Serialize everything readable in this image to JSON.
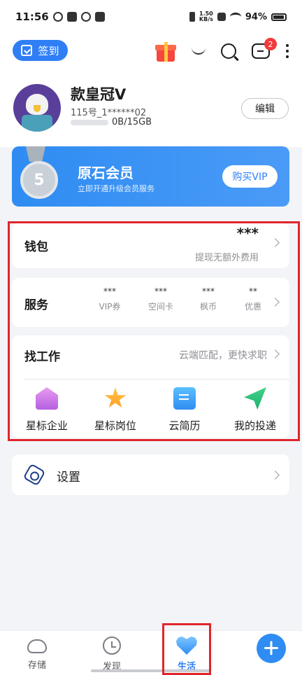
{
  "status_bar": {
    "time": "11:56",
    "net_speed_top": "1.50",
    "net_speed_bottom": "KB/s",
    "battery": "94%"
  },
  "header": {
    "checkin_label": "签到",
    "message_badge": "2"
  },
  "profile": {
    "name": "款皇冠V",
    "id": "115号_1******02",
    "storage": "0B/15GB",
    "edit_label": "编辑"
  },
  "vip": {
    "medal_level": "5",
    "title": "原石会员",
    "subtitle": "立即开通升级会员服务",
    "button": "购买VIP"
  },
  "wallet": {
    "title": "钱包",
    "balance": "***",
    "note": "提现无额外费用"
  },
  "services": {
    "title": "服务",
    "items": [
      {
        "value": "***",
        "label": "VIP券"
      },
      {
        "value": "***",
        "label": "空间卡"
      },
      {
        "value": "***",
        "label": "枫币"
      },
      {
        "value": "**",
        "label": "优惠"
      }
    ]
  },
  "jobs": {
    "title": "找工作",
    "slogan": "云端匹配，更快求职",
    "items": [
      {
        "label": "星标企业",
        "icon": "building-icon"
      },
      {
        "label": "星标岗位",
        "icon": "star-icon"
      },
      {
        "label": "云简历",
        "icon": "resume-icon"
      },
      {
        "label": "我的投递",
        "icon": "paper-plane-icon"
      }
    ]
  },
  "settings": {
    "label": "设置"
  },
  "bottom_nav": {
    "items": [
      {
        "label": "存储",
        "icon": "cloud-icon"
      },
      {
        "label": "发现",
        "icon": "clock-icon"
      },
      {
        "label": "生活",
        "icon": "heart-icon",
        "active": true
      }
    ],
    "fab_icon": "plus-icon"
  },
  "colors": {
    "accent": "#2f7ef6",
    "highlight_box": "#e0252c"
  }
}
